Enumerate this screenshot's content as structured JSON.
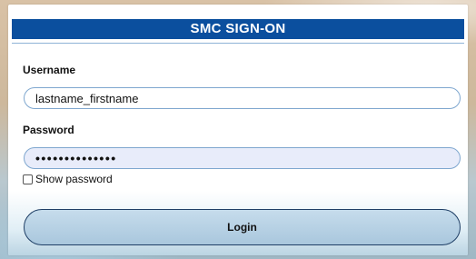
{
  "header": {
    "title": "SMC SIGN-ON"
  },
  "form": {
    "username_label": "Username",
    "username_value": "lastname_firstname",
    "password_label": "Password",
    "password_value": "••••••••••••••",
    "show_password_label": "Show password",
    "show_password_checked": false,
    "login_label": "Login"
  },
  "colors": {
    "header_bg": "#0b4f9e",
    "header_text": "#ffffff",
    "field_border": "#7fa7cf",
    "password_field_bg": "#e8ecfa",
    "login_button_bg": "#b5d0e4",
    "login_button_border": "#1f3f66"
  }
}
